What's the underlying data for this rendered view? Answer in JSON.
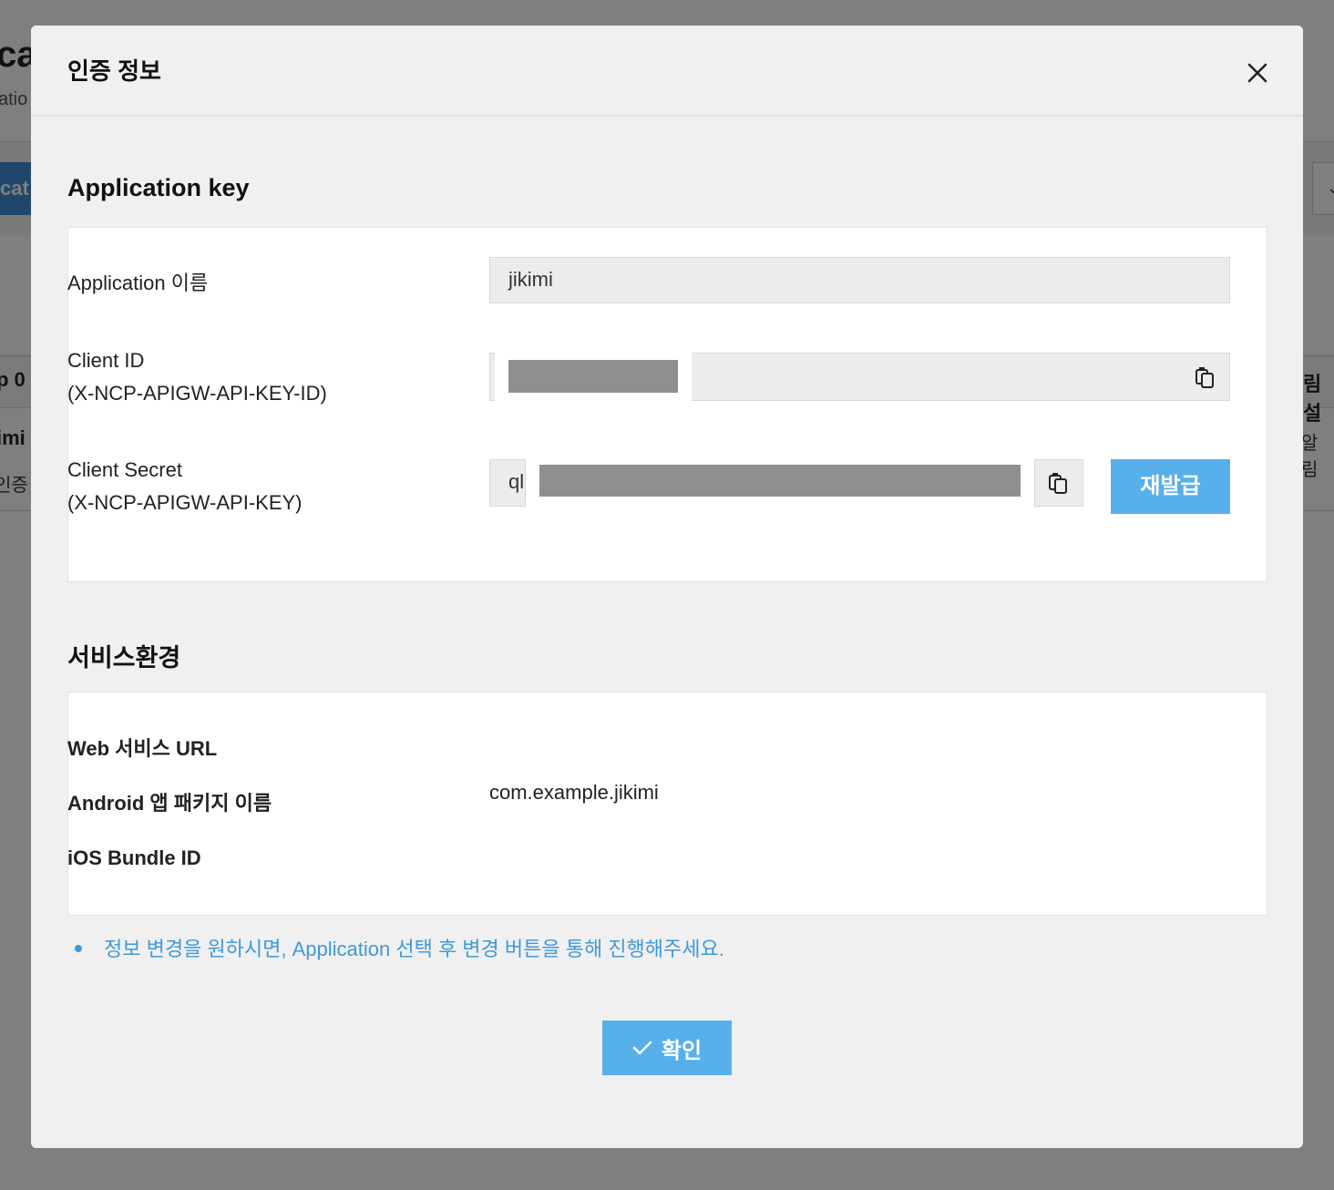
{
  "background": {
    "title_fragment": "ca",
    "subtitle_fragment": "atio",
    "button_fragment": "cat",
    "table_header_left": "p 0",
    "table_header_right": "림 설",
    "row_name": "imi",
    "row_sub": "인증",
    "row_right": "알림"
  },
  "modal": {
    "title": "인증 정보",
    "application_key_section": {
      "title": "Application key",
      "app_name_label": "Application 이름",
      "app_name_value": "jikimi",
      "client_id_label_line1": "Client ID",
      "client_id_label_line2": "(X-NCP-APIGW-API-KEY-ID)",
      "client_secret_label_line1": "Client Secret",
      "client_secret_label_line2": "(X-NCP-APIGW-API-KEY)",
      "client_secret_visible_prefix": "ql",
      "reissue_label": "재발급"
    },
    "service_env_section": {
      "title": "서비스환경",
      "web_url_label": "Web 서비스 URL",
      "android_label": "Android 앱 패키지 이름",
      "android_value": "com.example.jikimi",
      "ios_label": "iOS Bundle ID"
    },
    "note": "정보 변경을 원하시면, Application 선택 후 변경 버튼을 통해 진행해주세요.",
    "confirm_label": "확인"
  },
  "colors": {
    "accent": "#57b0ea",
    "note_text": "#3e9ad8",
    "mask": "#8f8f8f"
  },
  "icons": [
    "close-icon",
    "copy-icon",
    "check-icon"
  ]
}
